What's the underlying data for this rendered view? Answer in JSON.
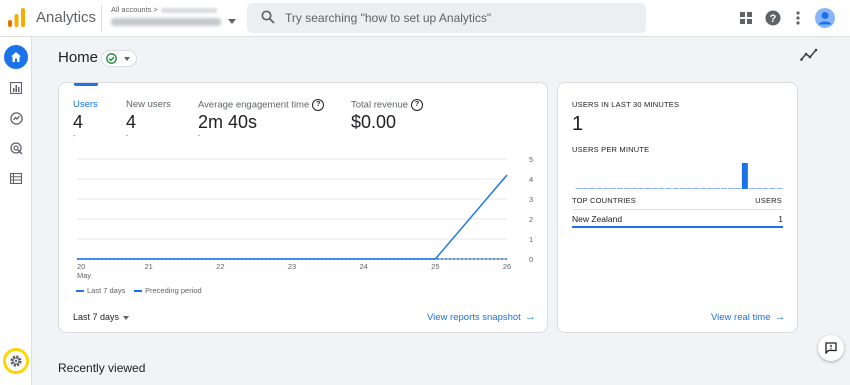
{
  "header": {
    "app_title": "Analytics",
    "account_crumb": "All accounts >",
    "search_placeholder": "Try searching \"how to set up Analytics\"",
    "icons": [
      "apps-icon",
      "help-icon",
      "more-vert-icon",
      "account-avatar-icon"
    ]
  },
  "rail": {
    "items": [
      "home-icon",
      "reports-icon",
      "explore-icon",
      "advertising-icon",
      "configure-icon"
    ],
    "admin_icon": "settings-gear-icon"
  },
  "page": {
    "title": "Home",
    "status_chip_icon": "check-circle-icon",
    "insights_icon": "insights-icon"
  },
  "overview": {
    "metrics": [
      {
        "label": "Users",
        "value": "4",
        "delta": "-"
      },
      {
        "label": "New users",
        "value": "4",
        "delta": "-"
      },
      {
        "label": "Average engagement time",
        "value": "2m 40s",
        "delta": "-"
      },
      {
        "label": "Total revenue",
        "value": "$0.00",
        "delta": ""
      }
    ],
    "legend": {
      "current": "Last 7 days",
      "previous": "Preceding period"
    },
    "date_range": "Last 7 days",
    "link": "View reports snapshot"
  },
  "chart_data": {
    "type": "line",
    "x": [
      "20",
      "21",
      "22",
      "23",
      "24",
      "25",
      "26"
    ],
    "x_sublabel_first": "May",
    "series": [
      {
        "name": "Last 7 days",
        "values": [
          0,
          0,
          0,
          0,
          0,
          0,
          4.2
        ],
        "style": "solid"
      },
      {
        "name": "Preceding period",
        "values": [
          0,
          0,
          0,
          0,
          0,
          0,
          0
        ],
        "style": "dashed"
      }
    ],
    "yticks": [
      "0",
      "1",
      "2",
      "3",
      "4",
      "5"
    ],
    "ylim": [
      0,
      5
    ],
    "y_axis_side": "right",
    "grid": true,
    "color": "#1a73e8"
  },
  "realtime": {
    "users_label": "USERS IN LAST 30 MINUTES",
    "users_value": "1",
    "per_minute_label": "USERS PER MINUTE",
    "per_minute_bars": [
      0,
      0,
      0,
      0,
      0,
      0,
      0,
      0,
      0,
      0,
      0,
      0,
      0,
      0,
      0,
      0,
      0,
      0,
      0,
      0,
      0,
      0,
      0,
      0,
      1,
      0,
      0,
      0,
      0,
      0
    ],
    "countries_header": "TOP COUNTRIES",
    "users_header": "USERS",
    "rows": [
      {
        "country": "New Zealand",
        "users": "1"
      }
    ],
    "link": "View real time"
  },
  "recent": {
    "title": "Recently viewed"
  },
  "colors": {
    "accent": "#1a73e8",
    "logo_orange": "#f9ab00",
    "logo_dark_orange": "#e37400",
    "highlight": "#ffd600"
  }
}
